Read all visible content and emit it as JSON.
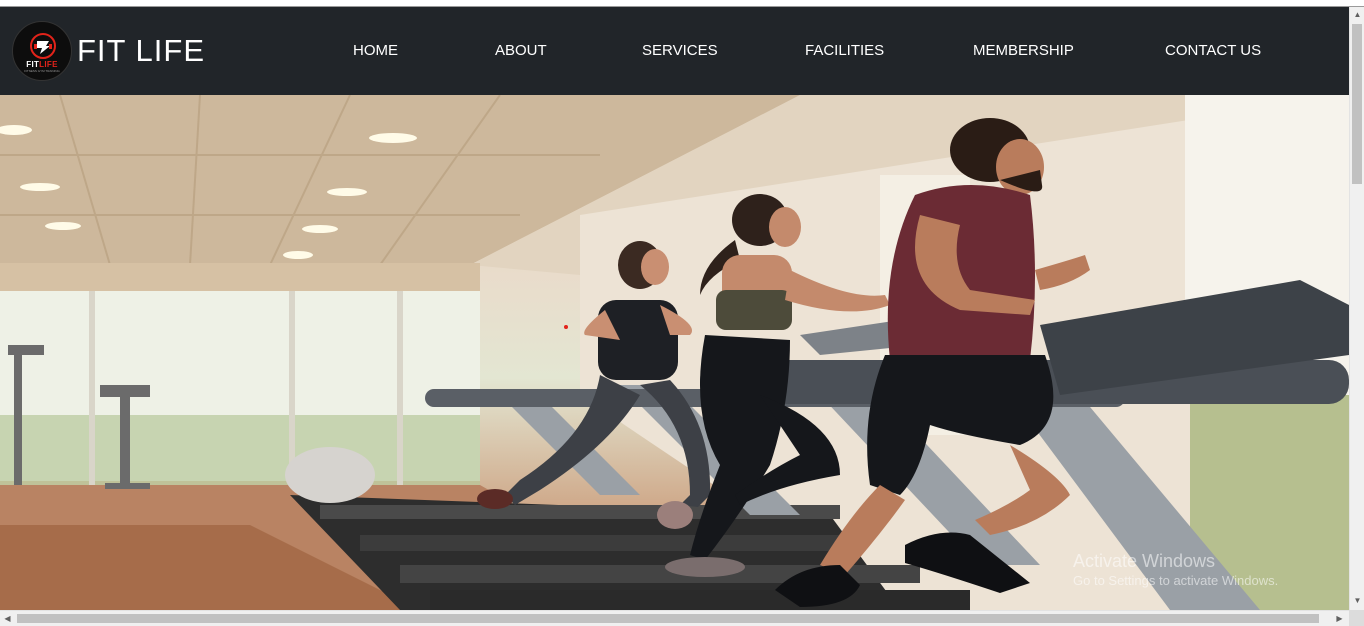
{
  "brand": {
    "name": "FIT LIFE",
    "logo_text_white": "FIT",
    "logo_text_red": "LIFE",
    "logo_tagline": "FITNESS GYM TRAINING"
  },
  "nav": {
    "items": [
      {
        "label": "HOME"
      },
      {
        "label": "ABOUT"
      },
      {
        "label": "SERVICES"
      },
      {
        "label": "FACILITIES"
      },
      {
        "label": "MEMBERSHIP"
      },
      {
        "label": "CONTACT US"
      }
    ]
  },
  "hero": {
    "image_alt": "People running on treadmills in a gym"
  },
  "watermark": {
    "title": "Activate Windows",
    "subtitle": "Go to Settings to activate Windows."
  },
  "colors": {
    "navbar": "#212529",
    "nav_text": "#ffffff",
    "logo_accent": "#e2231a"
  },
  "icons": {
    "scroll_up": "arrow-up-icon",
    "scroll_down": "arrow-down-icon",
    "scroll_left": "arrow-left-icon",
    "scroll_right": "arrow-right-icon"
  }
}
